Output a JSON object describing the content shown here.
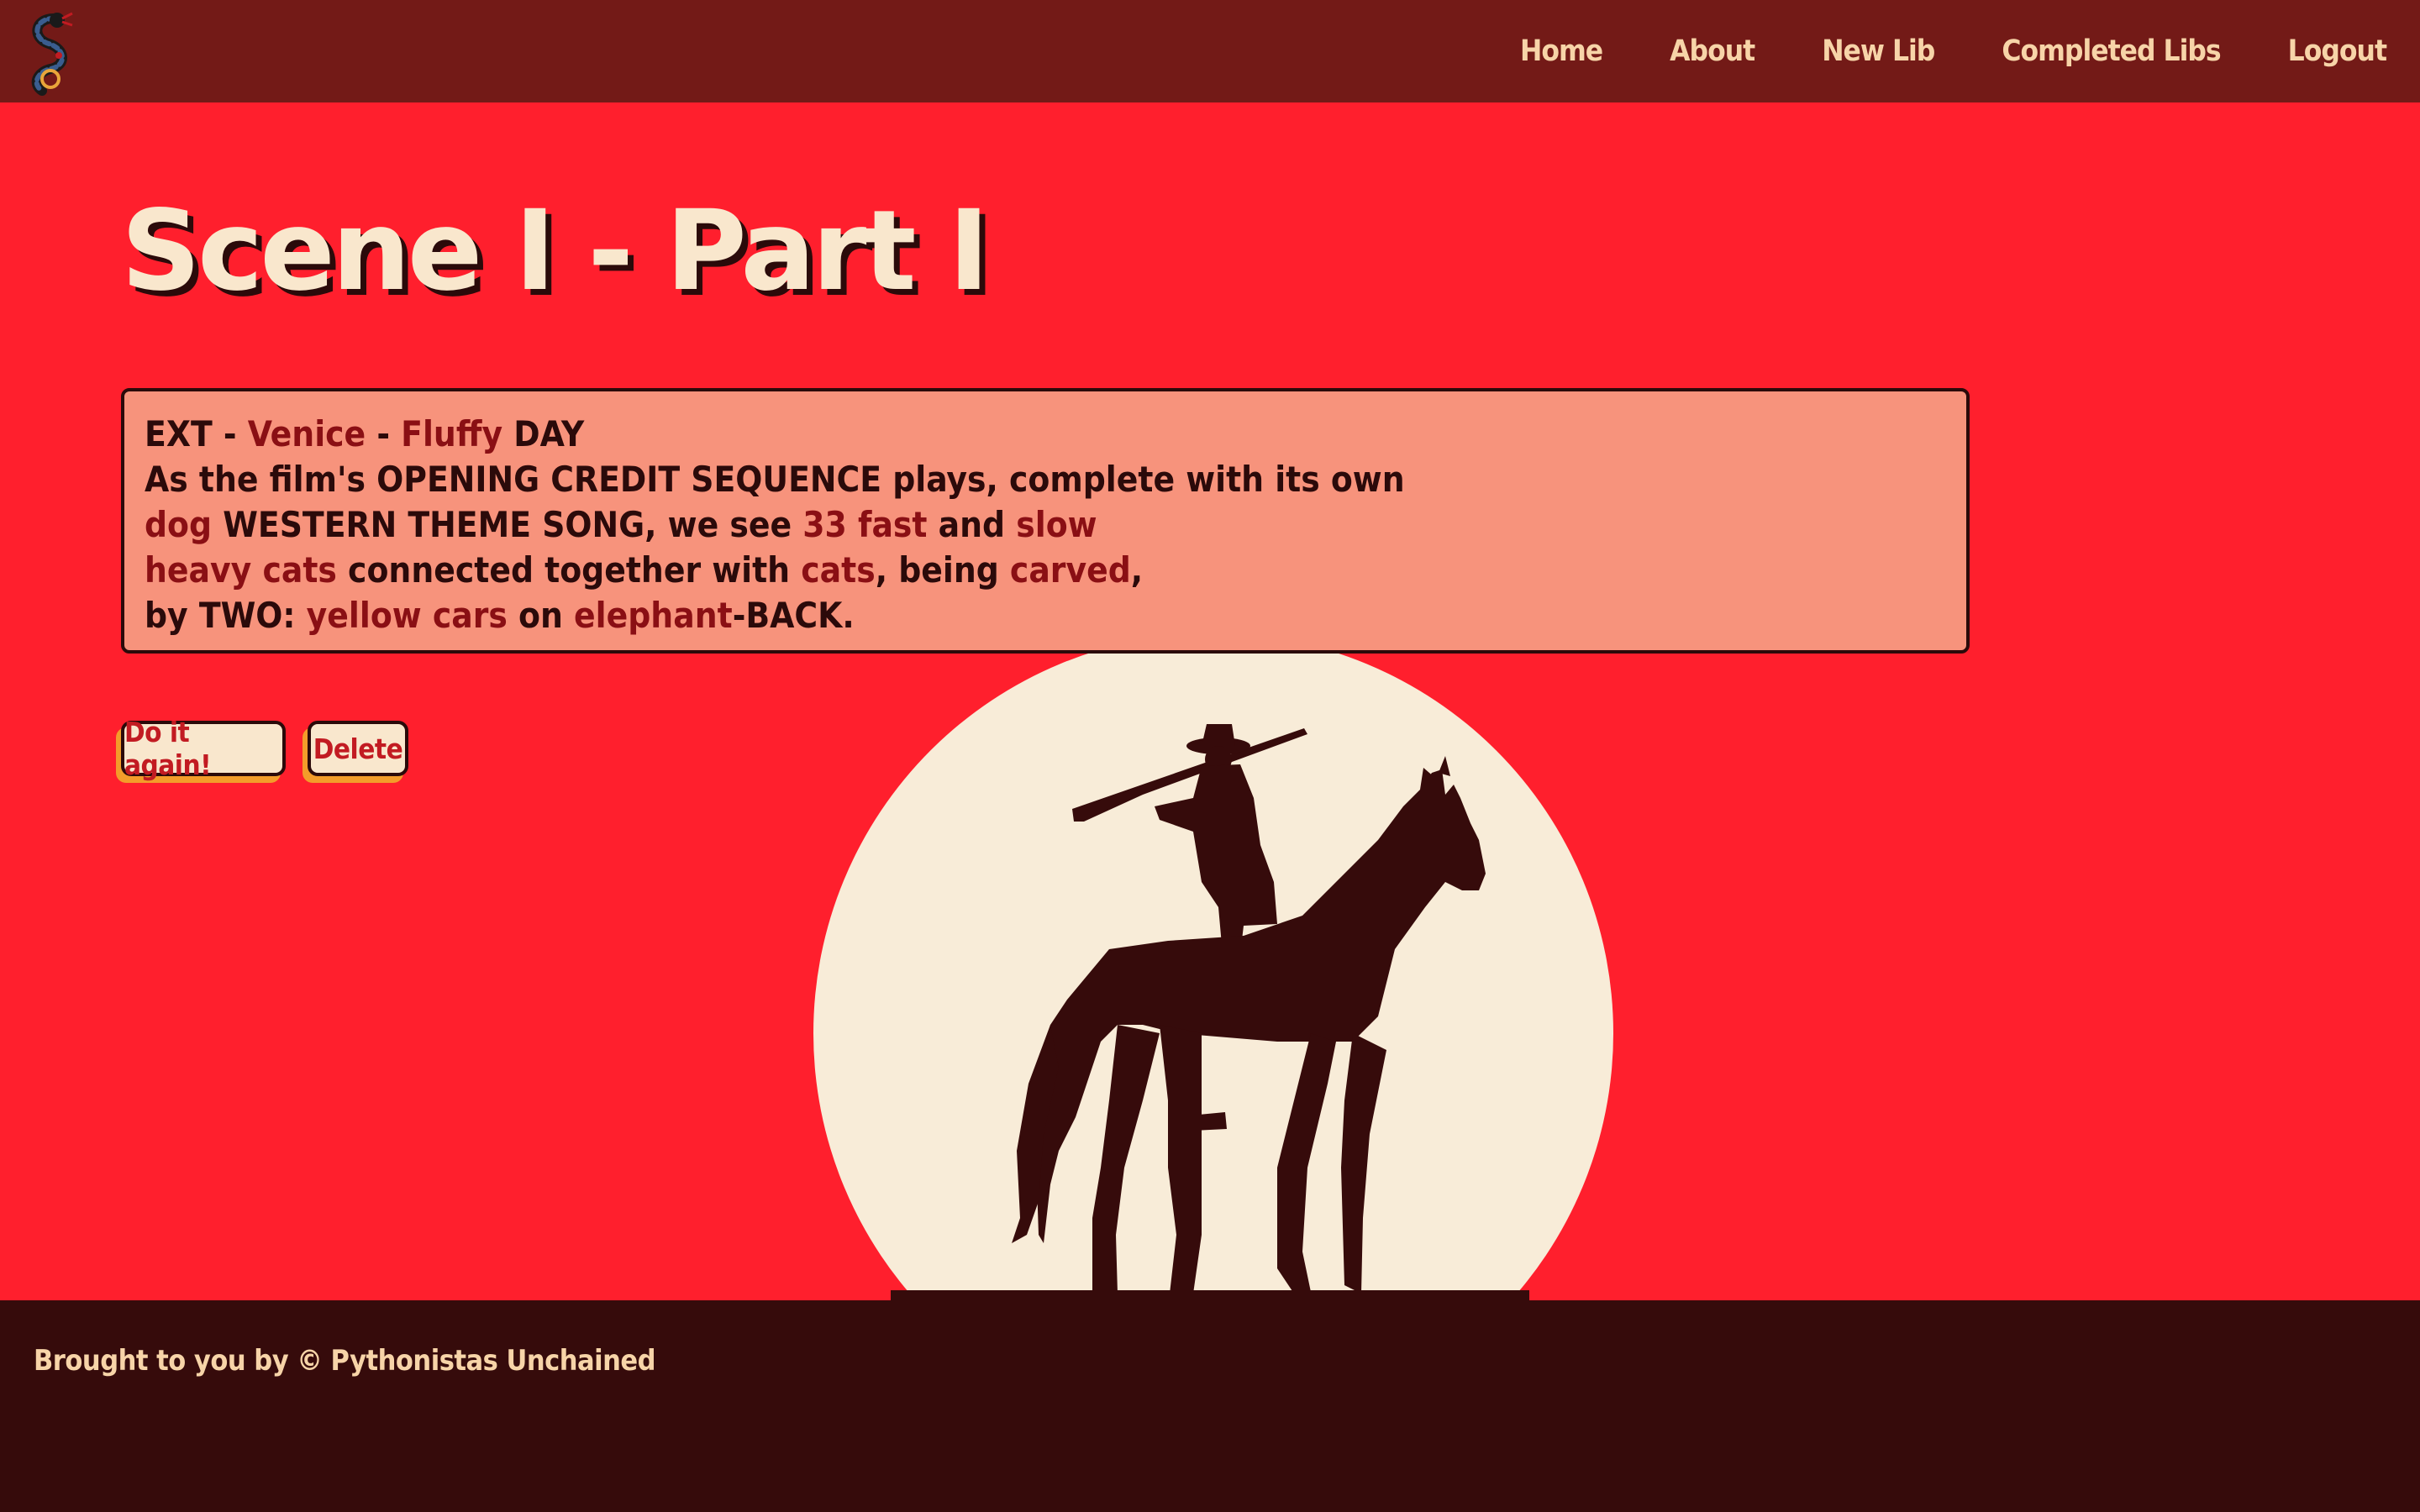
{
  "nav": {
    "logo_icon": "serpent-logo-icon",
    "links": [
      "Home",
      "About",
      "New Lib",
      "Completed Libs",
      "Logout"
    ]
  },
  "page": {
    "title": "Scene I - Part I"
  },
  "scene": {
    "line1": {
      "a": "EXT - ",
      "b": "Venice",
      "c": " - ",
      "d": "Fluffy",
      "e": " DAY"
    },
    "line2": "As the film's OPENING CREDIT SEQUENCE plays, complete with its own",
    "line3": {
      "a": "dog",
      "b": " WESTERN THEME SONG, we see ",
      "c": "33",
      "d": " ",
      "e": "fast",
      "f": " and ",
      "g": "slow"
    },
    "line4": {
      "a": "heavy",
      "b": " ",
      "c": "cats",
      "d": " connected together with ",
      "e": "cats",
      "f": ", being ",
      "g": "carved",
      "h": ","
    },
    "line5": {
      "a": "by TWO: ",
      "b": "yellow",
      "c": " ",
      "d": "cars",
      "e": " on ",
      "f": "elephant",
      "g": "-BACK."
    }
  },
  "buttons": {
    "again": "Do it again!",
    "delete": "Delete"
  },
  "footer": {
    "text": "Brought to you by © Pythonistas Unchained"
  },
  "colors": {
    "background": "#ff1f2d",
    "navbar": "#731a17",
    "footer": "#360b0b",
    "cream": "#f9e7cd",
    "madlib_word": "#8a0f14"
  }
}
